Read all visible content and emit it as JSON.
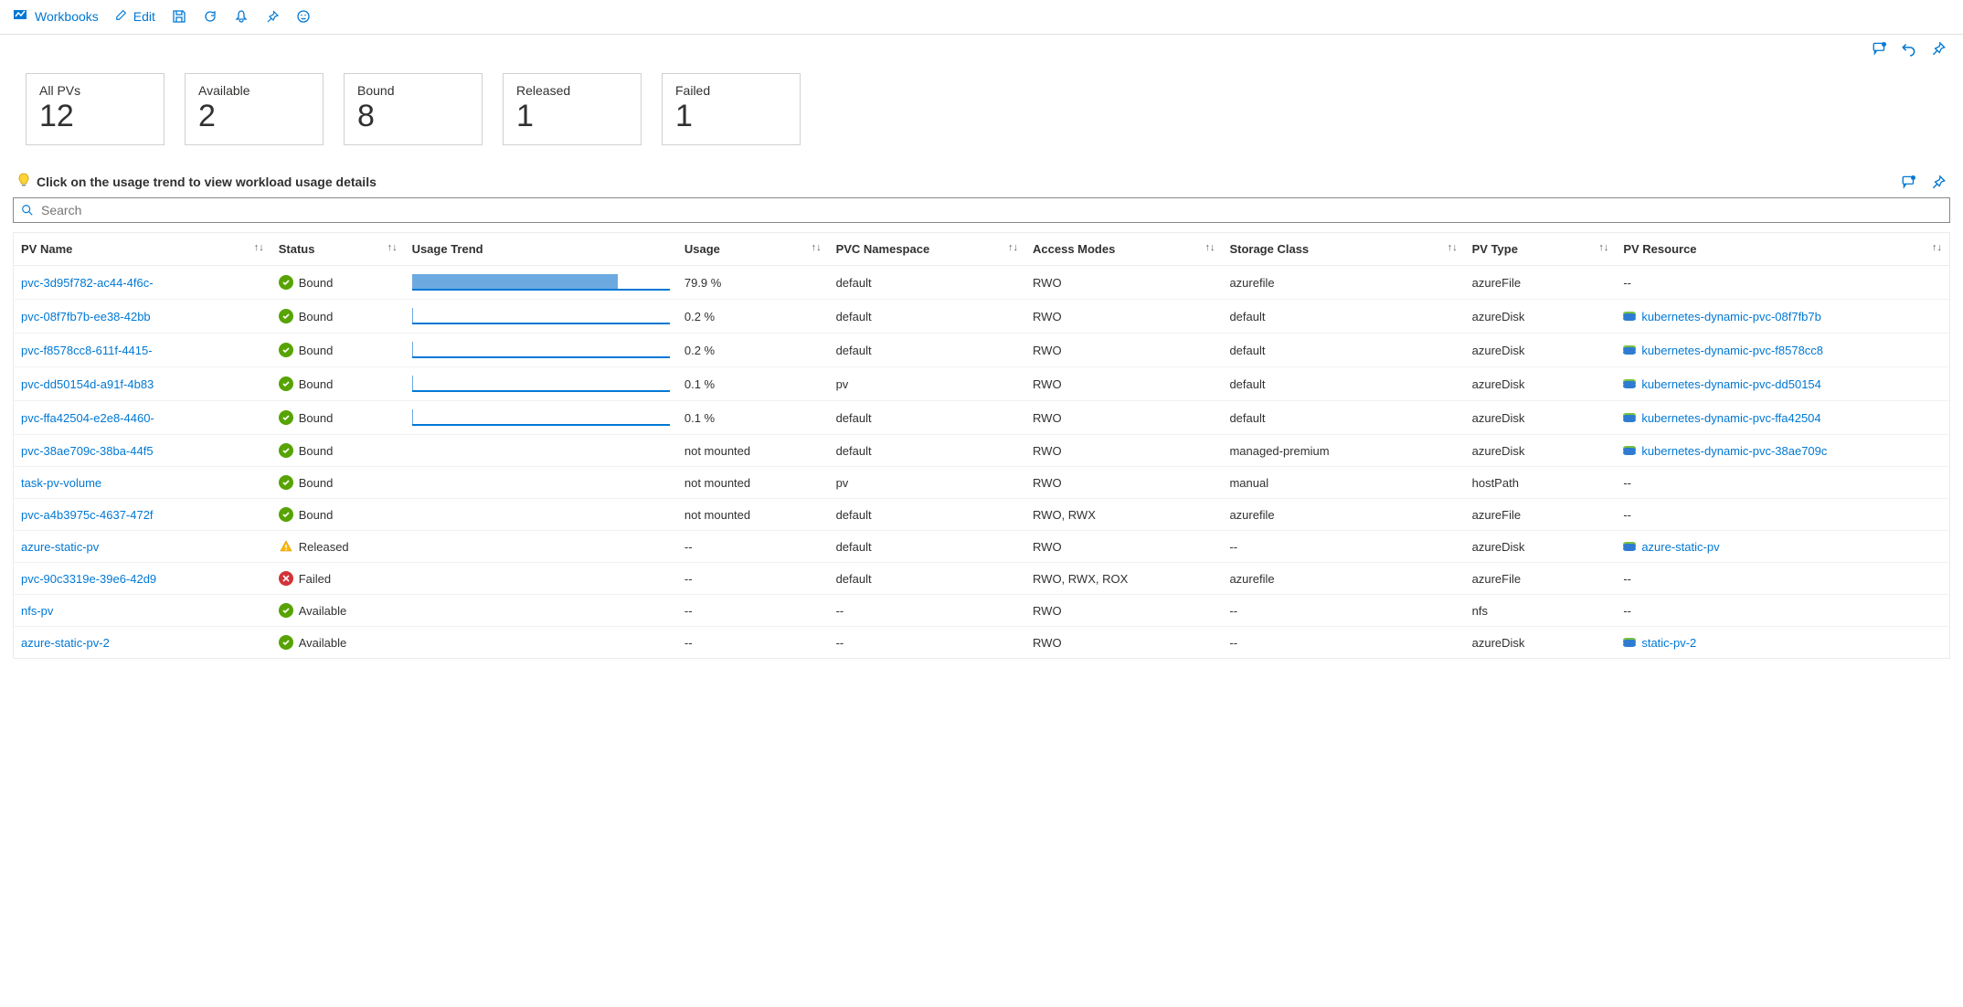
{
  "toolbar": {
    "brand": "Workbooks",
    "edit": "Edit"
  },
  "tiles": [
    {
      "label": "All PVs",
      "value": "12"
    },
    {
      "label": "Available",
      "value": "2"
    },
    {
      "label": "Bound",
      "value": "8"
    },
    {
      "label": "Released",
      "value": "1"
    },
    {
      "label": "Failed",
      "value": "1"
    }
  ],
  "hint": "Click on the usage trend to view workload usage details",
  "search_placeholder": "Search",
  "columns": {
    "pv_name": "PV Name",
    "status": "Status",
    "usage_trend": "Usage Trend",
    "usage": "Usage",
    "pvc_namespace": "PVC Namespace",
    "access_modes": "Access Modes",
    "storage_class": "Storage Class",
    "pv_type": "PV Type",
    "pv_resource": "PV Resource"
  },
  "rows": [
    {
      "pv": "pvc-3d95f782-ac44-4f6c-",
      "status": "Bound",
      "status_kind": "ok",
      "trend": 79.9,
      "usage": "79.9 %",
      "ns": "default",
      "access": "RWO",
      "sc": "azurefile",
      "type": "azureFile",
      "res": "--"
    },
    {
      "pv": "pvc-08f7fb7b-ee38-42bb",
      "status": "Bound",
      "status_kind": "ok",
      "trend": 0.2,
      "usage": "0.2 %",
      "ns": "default",
      "access": "RWO",
      "sc": "default",
      "type": "azureDisk",
      "res": "kubernetes-dynamic-pvc-08f7fb7b"
    },
    {
      "pv": "pvc-f8578cc8-611f-4415-",
      "status": "Bound",
      "status_kind": "ok",
      "trend": 0.2,
      "usage": "0.2 %",
      "ns": "default",
      "access": "RWO",
      "sc": "default",
      "type": "azureDisk",
      "res": "kubernetes-dynamic-pvc-f8578cc8"
    },
    {
      "pv": "pvc-dd50154d-a91f-4b83",
      "status": "Bound",
      "status_kind": "ok",
      "trend": 0.1,
      "usage": "0.1 %",
      "ns": "pv",
      "access": "RWO",
      "sc": "default",
      "type": "azureDisk",
      "res": "kubernetes-dynamic-pvc-dd50154"
    },
    {
      "pv": "pvc-ffa42504-e2e8-4460-",
      "status": "Bound",
      "status_kind": "ok",
      "trend": 0.1,
      "usage": "0.1 %",
      "ns": "default",
      "access": "RWO",
      "sc": "default",
      "type": "azureDisk",
      "res": "kubernetes-dynamic-pvc-ffa42504"
    },
    {
      "pv": "pvc-38ae709c-38ba-44f5",
      "status": "Bound",
      "status_kind": "ok",
      "trend": null,
      "usage": "not mounted",
      "ns": "default",
      "access": "RWO",
      "sc": "managed-premium",
      "type": "azureDisk",
      "res": "kubernetes-dynamic-pvc-38ae709c"
    },
    {
      "pv": "task-pv-volume",
      "status": "Bound",
      "status_kind": "ok",
      "trend": null,
      "usage": "not mounted",
      "ns": "pv",
      "access": "RWO",
      "sc": "manual",
      "type": "hostPath",
      "res": "--"
    },
    {
      "pv": "pvc-a4b3975c-4637-472f",
      "status": "Bound",
      "status_kind": "ok",
      "trend": null,
      "usage": "not mounted",
      "ns": "default",
      "access": "RWO, RWX",
      "sc": "azurefile",
      "type": "azureFile",
      "res": "--"
    },
    {
      "pv": "azure-static-pv",
      "status": "Released",
      "status_kind": "warn",
      "trend": null,
      "usage": "--",
      "ns": "default",
      "access": "RWO",
      "sc": "--",
      "type": "azureDisk",
      "res": "azure-static-pv"
    },
    {
      "pv": "pvc-90c3319e-39e6-42d9",
      "status": "Failed",
      "status_kind": "err",
      "trend": null,
      "usage": "--",
      "ns": "default",
      "access": "RWO, RWX, ROX",
      "sc": "azurefile",
      "type": "azureFile",
      "res": "--"
    },
    {
      "pv": "nfs-pv",
      "status": "Available",
      "status_kind": "ok",
      "trend": null,
      "usage": "--",
      "ns": "--",
      "access": "RWO",
      "sc": "--",
      "type": "nfs",
      "res": "--"
    },
    {
      "pv": "azure-static-pv-2",
      "status": "Available",
      "status_kind": "ok",
      "trend": null,
      "usage": "--",
      "ns": "--",
      "access": "RWO",
      "sc": "--",
      "type": "azureDisk",
      "res": "static-pv-2"
    }
  ]
}
